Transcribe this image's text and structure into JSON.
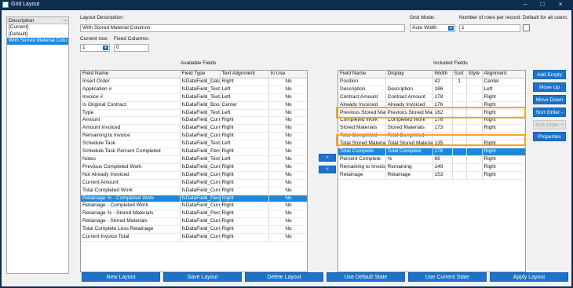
{
  "window": {
    "title": "Grid Layout",
    "minimize": "–",
    "maximize": "□",
    "close": "×"
  },
  "layouts": {
    "header": "Description",
    "items": [
      "[Current]",
      "[Default]",
      "With Stored Material Colu"
    ],
    "selected_index": 2
  },
  "form": {
    "layout_description_label": "Layout Description:",
    "layout_description_value": "With Stored Material Columns",
    "grid_mode_label": "Grid Mode:",
    "grid_mode_value": "Auto Width",
    "rows_per_record_label": "Number of rows per record:",
    "rows_per_record_value": "1",
    "default_all_users_label": "Default for all users:",
    "current_row_label": "Current row:",
    "current_row_value": "1",
    "fixed_columns_label": "Fixed Columns:",
    "fixed_columns_value": "0"
  },
  "available": {
    "title": "Available Fields",
    "columns": [
      "Field Name",
      "Field Type",
      "Text Alignment",
      "In Use"
    ],
    "selected_index": 15,
    "rows": [
      [
        "Insert Order",
        "fsDataField_Data",
        "Right",
        "No"
      ],
      [
        "Application #",
        "fsDataField_Text",
        "Left",
        "No"
      ],
      [
        "Invoice #",
        "fsDataField_Text",
        "Left",
        "No"
      ],
      [
        "Is Original Contract",
        "fsDataField_Boo",
        "Center",
        "No"
      ],
      [
        "Type",
        "fsDataField_Text",
        "Left",
        "No"
      ],
      [
        "Amount",
        "fsDataField_Curr",
        "Right",
        "No"
      ],
      [
        "Amount Invoiced",
        "fsDataField_Curr",
        "Right",
        "No"
      ],
      [
        "Remaining to Invoice",
        "fsDataField_Curr",
        "Right",
        "No"
      ],
      [
        "Schedule Task",
        "fsDataField_Text",
        "Left",
        "No"
      ],
      [
        "Schedule Task Percent Completed",
        "fsDataField_Perc",
        "Right",
        "No"
      ],
      [
        "Notes",
        "fsDataField_Text",
        "Left",
        "No"
      ],
      [
        "Previous Completed Work",
        "fsDataField_Curr",
        "Right",
        "No"
      ],
      [
        "Not Already Invoiced",
        "fsDataField_Curr",
        "Right",
        "No"
      ],
      [
        "Current Amount",
        "fsDataField_Curr",
        "Right",
        "No"
      ],
      [
        "Total Completed Work",
        "fsDataField_Curr",
        "Right",
        "No"
      ],
      [
        "Retainage % - Completed Work",
        "fsDataField_Perc",
        "Right",
        "No"
      ],
      [
        "Retainage - Completed Work",
        "fsDataField_Curr",
        "Right",
        "No"
      ],
      [
        "Retainage % - Stored Materials",
        "fsDataField_Perc",
        "Right",
        "No"
      ],
      [
        "Retainage - Stored Materials",
        "fsDataField_Curr",
        "Right",
        "No"
      ],
      [
        "Total Complete Less Retainage",
        "fsDataField_Curr",
        "Right",
        "No"
      ],
      [
        "Current Invoice Total",
        "fsDataField_Curr",
        "Right",
        "No"
      ]
    ]
  },
  "move": {
    "add": ">",
    "remove": "<"
  },
  "included": {
    "title": "Included Fields",
    "columns": [
      "Field Name",
      "Display",
      "Width",
      "Sort",
      "Style",
      "Alignment"
    ],
    "selected_index": 9,
    "rows": [
      [
        "Position",
        "",
        "42",
        "1",
        "",
        "Center"
      ],
      [
        "Description",
        "Description",
        "186",
        "",
        "",
        "Left"
      ],
      [
        "Contract Amount",
        "Contract Amount",
        "178",
        "",
        "",
        "Right"
      ],
      [
        "Already Invoiced",
        "Already Invoiced",
        "176",
        "",
        "",
        "Right"
      ],
      [
        "Previous Stored Mat",
        "Previous Stored Mat",
        "162",
        "",
        "",
        "Right"
      ],
      [
        "Completed Work",
        "Completed Work",
        "176",
        "",
        "",
        "Right"
      ],
      [
        "Stored Materials",
        "Stored Materials",
        "173",
        "",
        "",
        "Right"
      ],
      [
        "Total Completed",
        "Total Completed",
        "",
        "",
        "",
        ""
      ],
      [
        "Total Stored Materia",
        "Total Stored Materia",
        "135",
        "",
        "",
        "Right"
      ],
      [
        "Total Complete",
        "Total Complete",
        "176",
        "",
        "",
        "Right"
      ],
      [
        "Percent Complete",
        "%",
        "69",
        "",
        "",
        "Right"
      ],
      [
        "Remaining to Invoice",
        "Remaining",
        "149",
        "",
        "",
        "Right"
      ],
      [
        "Retainage",
        "Retainage",
        "153",
        "",
        "",
        "Right"
      ]
    ]
  },
  "side_buttons": {
    "add_empty": "Add Empty",
    "move_up": "Move Up",
    "move_down": "Move Down",
    "sort_order_minus": "Sort Order -",
    "sort_order_plus": "Sort Order +",
    "properties": "Properties"
  },
  "bottom_buttons": {
    "new_layout": "New Layout",
    "save_layout": "Save Layout",
    "delete_layout": "Delete Layout",
    "use_default_state": "Use Default State",
    "use_current_state": "Use Current State",
    "apply_layout": "Apply Layout"
  },
  "colors": {
    "accent": "#1e73c8",
    "selection": "#1e88d8",
    "highlight": "#f5a623"
  }
}
